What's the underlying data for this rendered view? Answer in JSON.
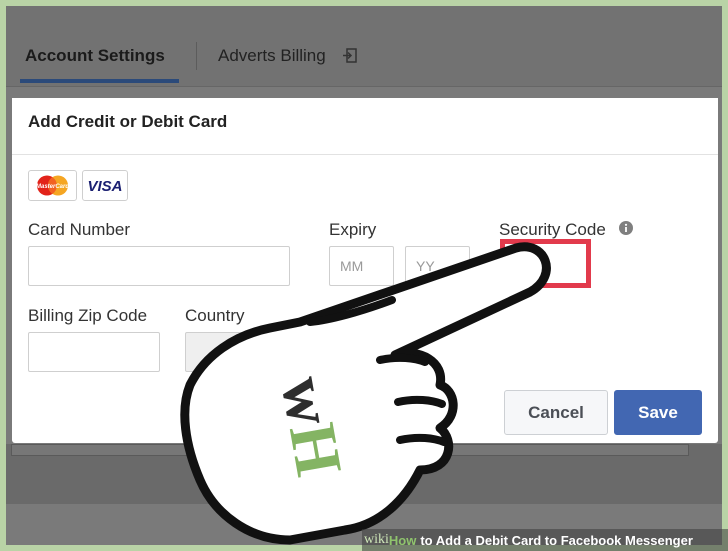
{
  "tabs": [
    {
      "label": "Account Settings",
      "active": true
    },
    {
      "label": "Adverts Billing",
      "active": false,
      "icon": "external-link-icon"
    }
  ],
  "dialog": {
    "title": "Add Credit or Debit Card",
    "card_logos": [
      "mastercard-logo",
      "visa-logo"
    ],
    "mastercard_text": "MasterCard",
    "visa_text": "VISA",
    "fields": {
      "card_number": {
        "label": "Card Number",
        "placeholder": ""
      },
      "expiry": {
        "label": "Expiry",
        "month_placeholder": "MM",
        "year_placeholder": "YY"
      },
      "security_code": {
        "label": "Security Code",
        "icon": "info-icon",
        "placeholder": ""
      },
      "billing_zip": {
        "label": "Billing Zip Code",
        "placeholder": ""
      },
      "country": {
        "label": "Country",
        "value": ""
      }
    },
    "buttons": {
      "cancel": "Cancel",
      "save": "Save"
    }
  },
  "colors": {
    "save_button": "#4267b2",
    "highlight": "#e23a4c",
    "tab_underline": "#2b4a7a"
  },
  "overlay": {
    "watermark": "wH",
    "caption_site": "wiki",
    "caption_how": "How",
    "caption_rest": "to Add a Debit Card to Facebook Messenger"
  }
}
